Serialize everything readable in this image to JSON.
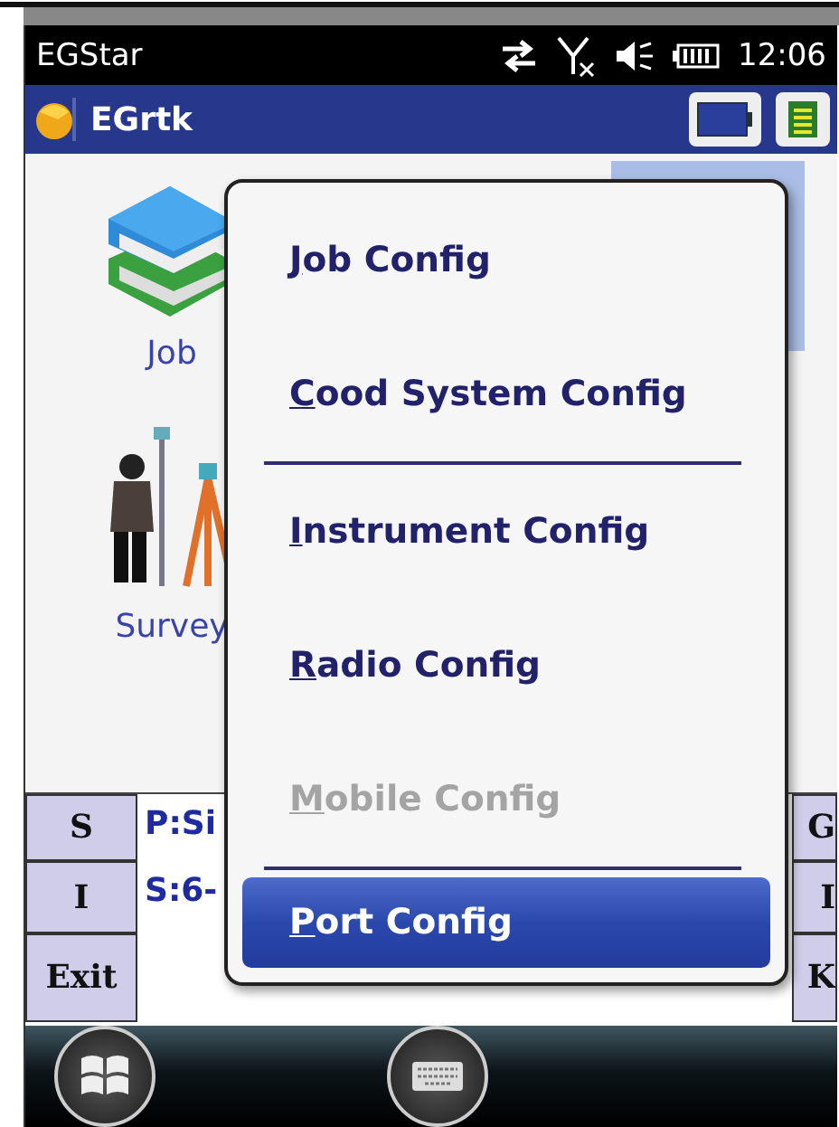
{
  "status_bar": {
    "app": "EGStar",
    "time": "12:06"
  },
  "title_bar": {
    "title": "EGrtk"
  },
  "tiles": [
    {
      "label": "Job",
      "kind": "books"
    },
    {
      "label": "Survey",
      "kind": "surveyor"
    }
  ],
  "bottom_panel": {
    "left_buttons": [
      "S",
      "I",
      "Exit"
    ],
    "lines": [
      "P:Si",
      "S:6-"
    ],
    "right_buttons": [
      "G",
      "I",
      "K"
    ]
  },
  "menu": {
    "items": [
      {
        "kind": "item",
        "label": "Job Config",
        "disabled": false,
        "selected": false
      },
      {
        "kind": "item",
        "label": "Cood System Config",
        "disabled": false,
        "selected": false
      },
      {
        "kind": "separator"
      },
      {
        "kind": "item",
        "label": "Instrument Config",
        "disabled": false,
        "selected": false
      },
      {
        "kind": "item",
        "label": "Radio Config",
        "disabled": false,
        "selected": false
      },
      {
        "kind": "item",
        "label": "Mobile Config",
        "disabled": true,
        "selected": false
      },
      {
        "kind": "separator"
      },
      {
        "kind": "item",
        "label": "Port Config",
        "disabled": false,
        "selected": true
      }
    ]
  }
}
